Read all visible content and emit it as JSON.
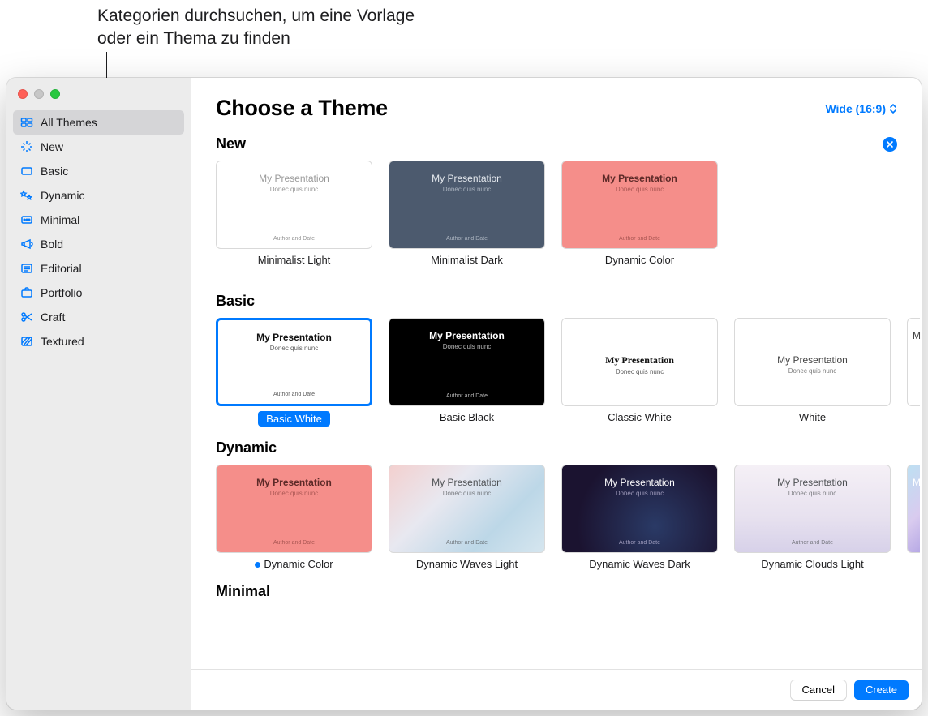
{
  "callout": "Kategorien durchsuchen, um eine Vorlage oder ein Thema zu finden",
  "header": {
    "title": "Choose a Theme",
    "aspect": "Wide (16:9)"
  },
  "sidebar": {
    "items": [
      {
        "label": "All Themes",
        "icon": "grid-icon",
        "selected": true
      },
      {
        "label": "New",
        "icon": "sparkle-icon"
      },
      {
        "label": "Basic",
        "icon": "rectangle-icon"
      },
      {
        "label": "Dynamic",
        "icon": "stars-icon"
      },
      {
        "label": "Minimal",
        "icon": "dots-icon"
      },
      {
        "label": "Bold",
        "icon": "megaphone-icon"
      },
      {
        "label": "Editorial",
        "icon": "news-icon"
      },
      {
        "label": "Portfolio",
        "icon": "briefcase-icon"
      },
      {
        "label": "Craft",
        "icon": "scissors-icon"
      },
      {
        "label": "Textured",
        "icon": "texture-icon"
      }
    ]
  },
  "sections": [
    {
      "title": "New",
      "closable": true,
      "themes": [
        {
          "name": "Minimalist Light",
          "style": "bg-white-light"
        },
        {
          "name": "Minimalist Dark",
          "style": "bg-dark-slate"
        },
        {
          "name": "Dynamic Color",
          "style": "bg-coral"
        }
      ]
    },
    {
      "title": "Basic",
      "themes": [
        {
          "name": "Basic White",
          "style": "bg-bw-white",
          "selected": true
        },
        {
          "name": "Basic Black",
          "style": "bg-black"
        },
        {
          "name": "Classic White",
          "style": "bg-classic",
          "serif": true,
          "center": true
        },
        {
          "name": "White",
          "style": "bg-plain",
          "center": true
        }
      ],
      "peek": "bg-plain"
    },
    {
      "title": "Dynamic",
      "themes": [
        {
          "name": "Dynamic Color",
          "style": "bg-coral",
          "dotted": true
        },
        {
          "name": "Dynamic Waves Light",
          "style": "bg-wave-light"
        },
        {
          "name": "Dynamic Waves Dark",
          "style": "bg-wave-dark"
        },
        {
          "name": "Dynamic Clouds Light",
          "style": "bg-clouds"
        }
      ],
      "peek": "bg-pastel-grad"
    },
    {
      "title": "Minimal",
      "cut": true
    }
  ],
  "thumb_text": {
    "title": "My Presentation",
    "subtitle": "Donec quis nunc",
    "author": "Author and Date"
  },
  "footer": {
    "cancel": "Cancel",
    "create": "Create"
  },
  "colors": {
    "accent": "#007aff",
    "sidebar_bg": "#ececec"
  }
}
